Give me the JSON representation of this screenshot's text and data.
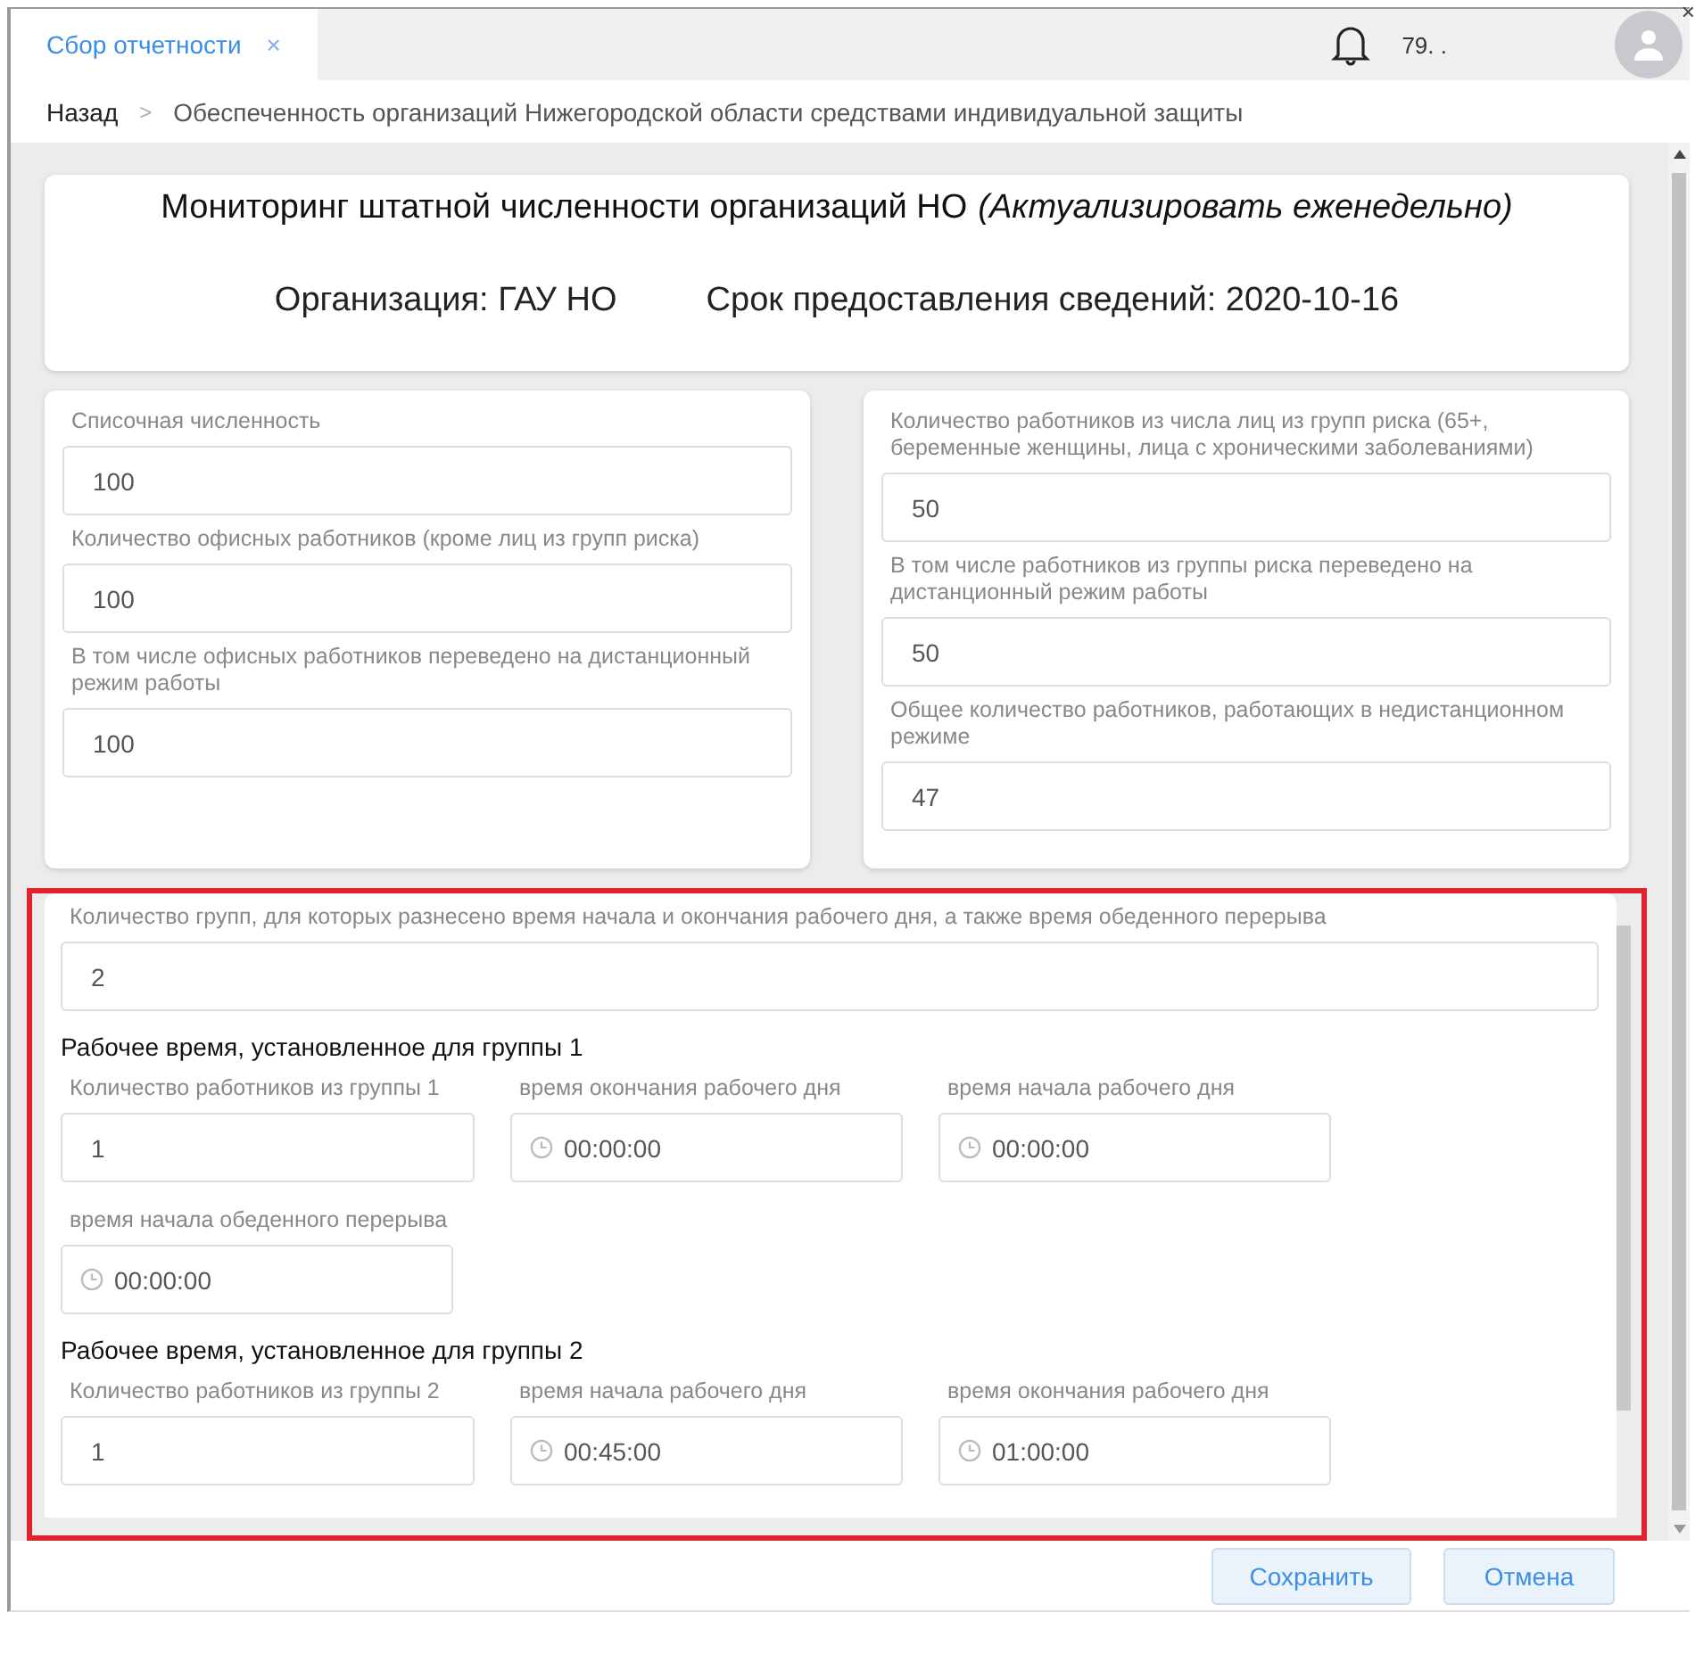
{
  "tabs": [
    {
      "label": "Сбор отчетности",
      "close": "×",
      "selected": true
    }
  ],
  "window_close": "×",
  "user": {
    "name": "79. ."
  },
  "breadcrumb": {
    "back": "Назад",
    "separator": ">",
    "current": "Обеспеченность организаций Нижегородской области средствами индивидуальной защиты"
  },
  "header": {
    "title": "Мониторинг штатной численности организаций НО",
    "title_note": "(Актуализировать еженедельно)",
    "organization": "Организация: ГАУ НО",
    "deadline": "Срок предоставления сведений: 2020-10-16"
  },
  "left_fields": [
    {
      "label": "Списочная численность",
      "value": "100"
    },
    {
      "label": "Количество офисных работников (кроме лиц из групп риска)",
      "value": "100"
    },
    {
      "label": "В том числе офисных работников переведено на дистанционный режим работы",
      "value": "100"
    }
  ],
  "right_fields": [
    {
      "label": "Количество работников из числа лиц из групп риска (65+, беременные женщины, лица с хроническими заболеваниями)",
      "value": "50"
    },
    {
      "label": "В том числе работников из группы риска переведено на дистанционный режим работы",
      "value": "50"
    },
    {
      "label": "Общее количество работников, работающих в недистанционном режиме",
      "value": "47"
    }
  ],
  "groups_count": {
    "label": "Количество групп, для которых разнесено время начала и окончания рабочего дня, а также время обеденного перерыва",
    "value": "2"
  },
  "groups": [
    {
      "title": "Рабочее время, установленное для группы 1",
      "fields": [
        {
          "kind": "number",
          "label": "Количество работников из группы 1",
          "value": "1"
        },
        {
          "kind": "time",
          "label": "время окончания рабочего дня",
          "value": "00:00:00"
        },
        {
          "kind": "time",
          "label": "время начала рабочего дня",
          "value": "00:00:00"
        },
        {
          "kind": "time",
          "label": "время начала обеденного перерыва",
          "value": "00:00:00"
        }
      ]
    },
    {
      "title": "Рабочее время, установленное для группы 2",
      "fields": [
        {
          "kind": "number",
          "label": "Количество работников из группы 2",
          "value": "1"
        },
        {
          "kind": "time",
          "label": "время начала рабочего дня",
          "value": "00:45:00"
        },
        {
          "kind": "time",
          "label": "время окончания рабочего дня",
          "value": "01:00:00"
        }
      ]
    }
  ],
  "buttons": [
    "Сохранить",
    "Отмена"
  ]
}
